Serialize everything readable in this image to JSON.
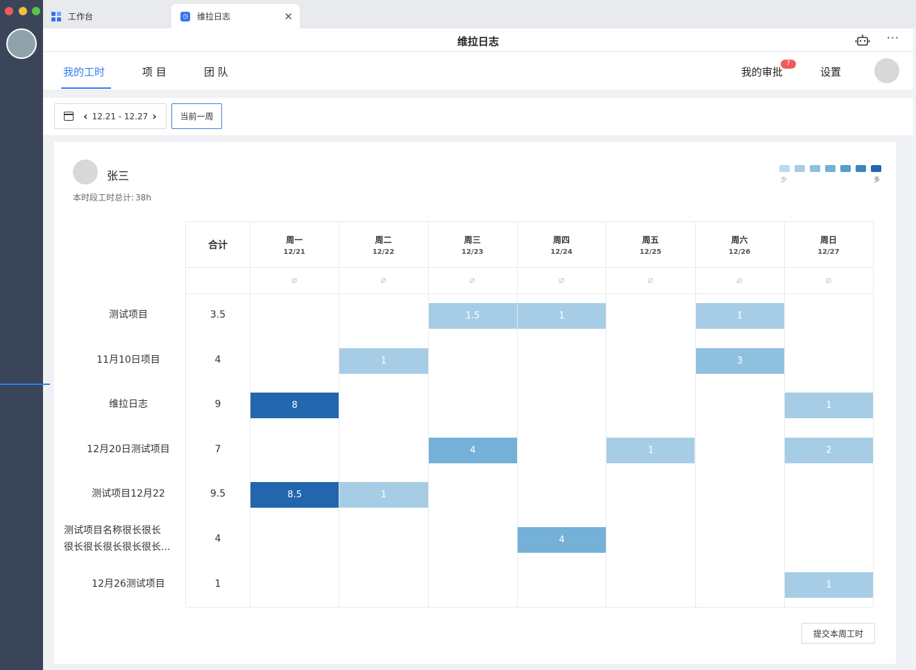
{
  "window": {
    "tabs": [
      {
        "label": "工作台",
        "icon": "grid-icon"
      },
      {
        "label": "维拉日志",
        "icon": "vera-log-icon"
      }
    ]
  },
  "titlebar": {
    "title": "维拉日志"
  },
  "nav": {
    "my_hours": "我的工时",
    "project": "项 目",
    "team": "团 队",
    "my_approval": "我的审批",
    "approval_badge": "7",
    "settings": "设置"
  },
  "toolbar": {
    "date_range": "12.21 - 12.27",
    "current_week": "当前一周"
  },
  "user": {
    "name": "张三",
    "total_label": "本时段工时总计:",
    "total_value": "38h"
  },
  "legend": {
    "low": "少",
    "high": "多",
    "colors": [
      "#bcd9ed",
      "#a7cde6",
      "#8fc0e0",
      "#74b0d8",
      "#579dcd",
      "#3a86c0",
      "#2266ad"
    ]
  },
  "table": {
    "total_header": "合计",
    "days": [
      {
        "name": "周一",
        "date": "12/21"
      },
      {
        "name": "周二",
        "date": "12/22"
      },
      {
        "name": "周三",
        "date": "12/23"
      },
      {
        "name": "周四",
        "date": "12/24"
      },
      {
        "name": "周五",
        "date": "12/25"
      },
      {
        "name": "周六",
        "date": "12/26"
      },
      {
        "name": "周日",
        "date": "12/27"
      }
    ],
    "projects": [
      {
        "name": "测试项目",
        "total": "3.5",
        "hours": [
          "",
          "",
          "1.5",
          "1",
          "",
          "1",
          ""
        ]
      },
      {
        "name": "11月10日项目",
        "total": "4",
        "hours": [
          "",
          "1",
          "",
          "",
          "",
          "3",
          ""
        ]
      },
      {
        "name": "维拉日志",
        "total": "9",
        "hours": [
          "8",
          "",
          "",
          "",
          "",
          "",
          "1"
        ]
      },
      {
        "name": "12月20日测试项目",
        "total": "7",
        "hours": [
          "",
          "",
          "4",
          "",
          "1",
          "",
          "2"
        ]
      },
      {
        "name": "测试项目12月22",
        "total": "9.5",
        "hours": [
          "8.5",
          "1",
          "",
          "",
          "",
          "",
          ""
        ]
      },
      {
        "name": "测试项目名称很长很长很长很长很长很长很长...",
        "name_line1": "测试项目名称很长很长",
        "name_line2": "很长很长很长很长很长...",
        "total": "4",
        "hours": [
          "",
          "",
          "",
          "4",
          "",
          "",
          ""
        ]
      },
      {
        "name": "12月26测试项目",
        "total": "1",
        "hours": [
          "",
          "",
          "",
          "",
          "",
          "",
          "1"
        ]
      }
    ]
  },
  "footer": {
    "submit": "提交本周工时"
  }
}
